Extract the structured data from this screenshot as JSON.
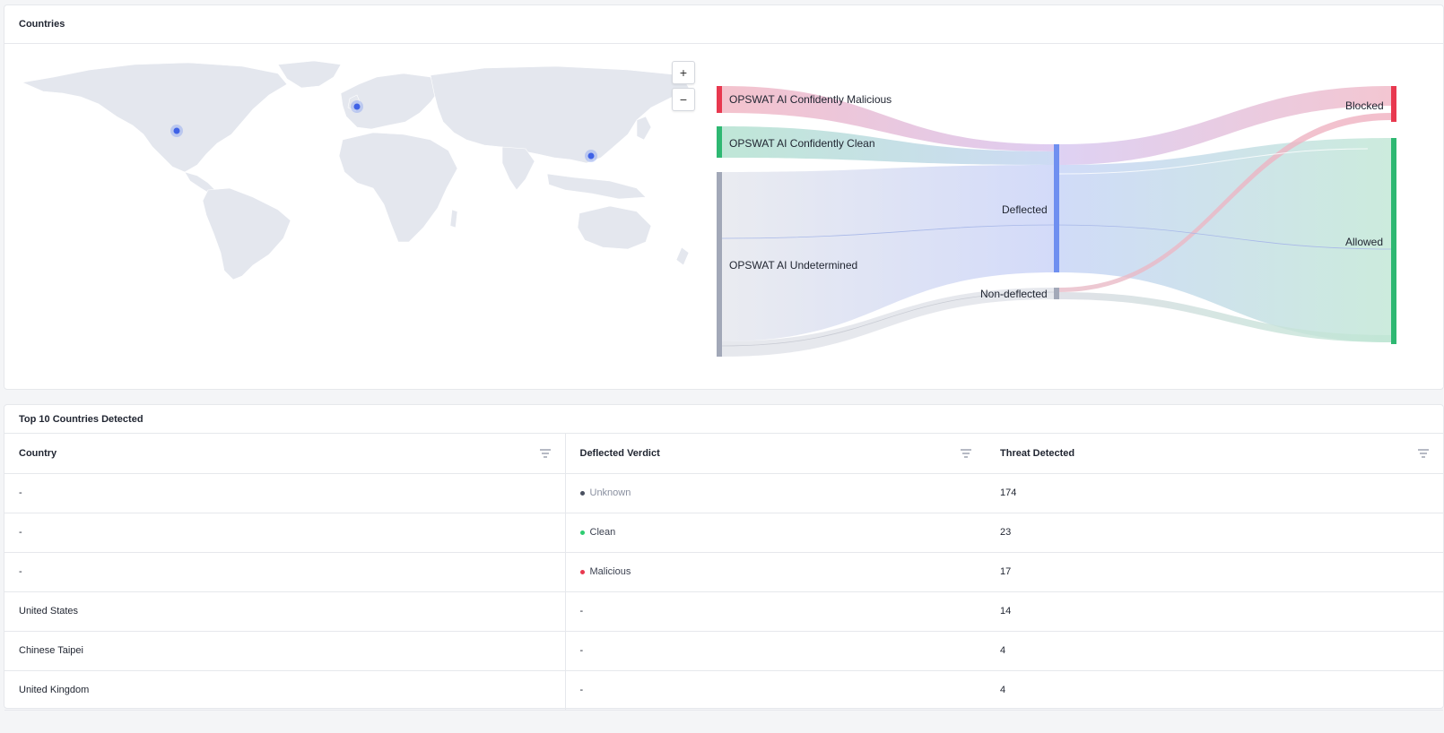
{
  "countries_card": {
    "title": "Countries",
    "zoom_in": "+",
    "zoom_out": "−"
  },
  "sankey": {
    "sources": [
      {
        "label": "OPSWAT AI Confidently Malicious",
        "color": "#e8384f"
      },
      {
        "label": "OPSWAT AI Confidently Clean",
        "color": "#2eb872"
      },
      {
        "label": "OPSWAT AI Undetermined",
        "color": "#a2a8b8"
      }
    ],
    "middle": [
      {
        "label": "Deflected",
        "color": "#6f8ff0"
      },
      {
        "label": "Non-deflected",
        "color": "#a2a8b8"
      }
    ],
    "targets": [
      {
        "label": "Blocked",
        "color": "#e8384f"
      },
      {
        "label": "Allowed",
        "color": "#2eb872"
      }
    ]
  },
  "table_card": {
    "title": "Top 10 Countries Detected",
    "columns": [
      "Country",
      "Deflected Verdict",
      "Threat Detected"
    ],
    "rows": [
      {
        "country": "-",
        "verdict": "Unknown",
        "verdict_color": "#4a5060",
        "threats": "174"
      },
      {
        "country": "-",
        "verdict": "Clean",
        "verdict_color": "#2ecc71",
        "threats": "23"
      },
      {
        "country": "-",
        "verdict": "Malicious",
        "verdict_color": "#e8384f",
        "threats": "17"
      },
      {
        "country": "United States",
        "verdict": "-",
        "verdict_color": "",
        "threats": "14"
      },
      {
        "country": "Chinese Taipei",
        "verdict": "-",
        "verdict_color": "",
        "threats": "4"
      },
      {
        "country": "United Kingdom",
        "verdict": "-",
        "verdict_color": "",
        "threats": "4"
      }
    ]
  }
}
